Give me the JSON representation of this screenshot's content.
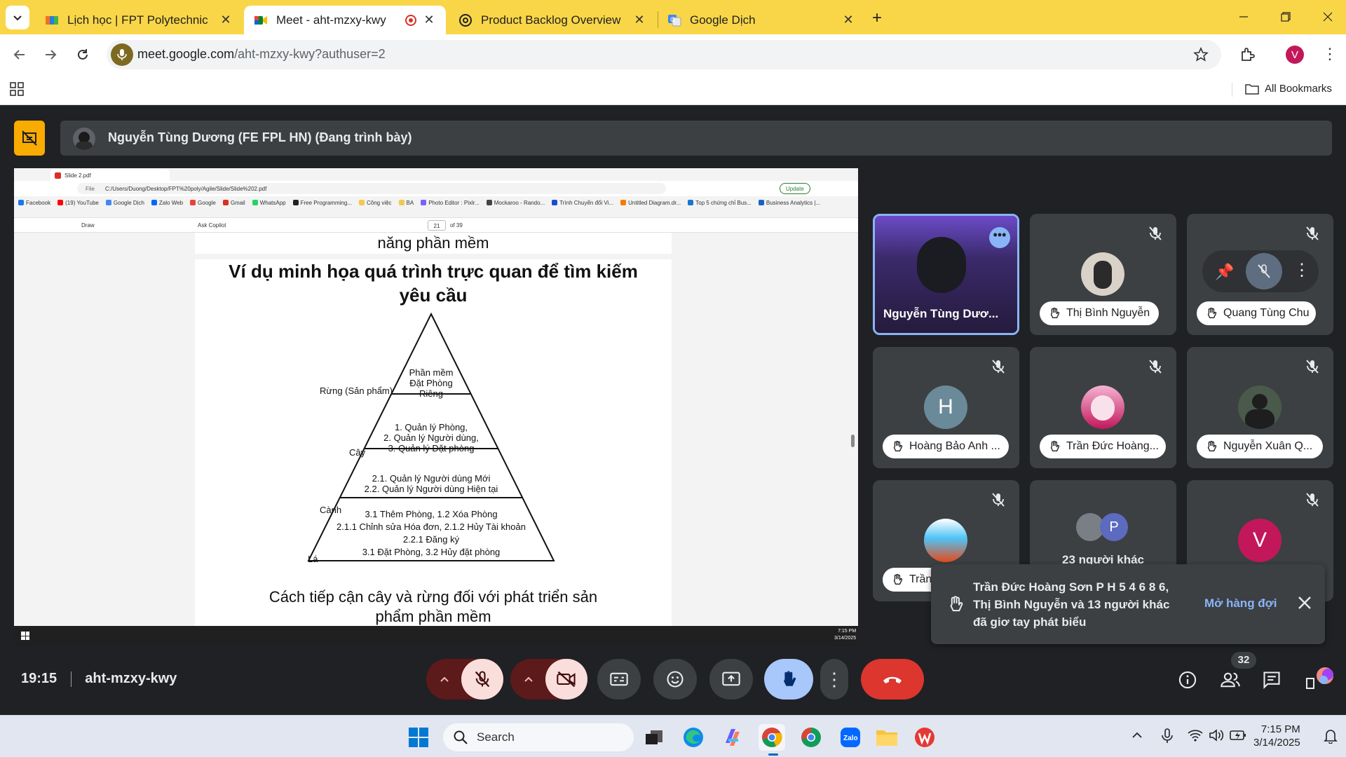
{
  "browser": {
    "tabs": [
      {
        "title": "Lịch học | FPT Polytechnic",
        "active": false
      },
      {
        "title": "Meet - aht-mzxy-kwy",
        "active": true
      },
      {
        "title": "Product Backlog Overview",
        "active": false
      },
      {
        "title": "Google Dịch",
        "active": false
      }
    ],
    "url_host": "meet.google.com",
    "url_path": "/aht-mzxy-kwy?authuser=2",
    "profile_initial": "V",
    "all_bookmarks": "All Bookmarks"
  },
  "meet": {
    "presenter_label": "Nguyễn Tùng Dương (FE FPL HN) (Đang trình bày)",
    "time": "19:15",
    "meeting_code": "aht-mzxy-kwy",
    "participants_count": "32",
    "tiles": [
      {
        "name": "Nguyễn Tùng Dươ...",
        "highlighted": true
      },
      {
        "name": "Thị Bình Nguyễn"
      },
      {
        "name": "Quang Tùng Chu"
      },
      {
        "name": "Hoàng Bảo Anh ...",
        "initial": "H"
      },
      {
        "name": "Trần Đức Hoàng..."
      },
      {
        "name": "Nguyễn Xuân Q..."
      },
      {
        "name": "Trần"
      },
      {
        "name": "23 người khác",
        "badge": "P"
      },
      {
        "name": "",
        "initial": "V"
      }
    ],
    "notification": {
      "text": "Trần Đức Hoàng Sơn P H 5 4 6 8 6, Thị Bình Nguyễn và 13 người khác đã giơ tay phát biểu",
      "action": "Mở hàng đợi"
    }
  },
  "shared_screen": {
    "tab_title": "Slide 2.pdf",
    "address": "C:/Users/Duong/Desktop/FPT%20poly/Agile/Slide/Slide%202.pdf",
    "file_label": "File",
    "update_label": "Update",
    "bookmarks": [
      "Facebook",
      "(19) YouTube",
      "Google Dịch",
      "Zalo Web",
      "Google",
      "Gmail",
      "WhatsApp",
      "Free Programming...",
      "Công việc",
      "BA",
      "Photo Editor : Pixlr...",
      "Mockaroo - Rando...",
      "Trình Chuyển đổi Vi...",
      "Untitled Diagram.dr...",
      "Top 5 chứng chỉ Bus...",
      "Business Analytics |..."
    ],
    "pdf_toolbar": {
      "draw": "Draw",
      "ask_copilot": "Ask Copilot",
      "page": "21",
      "of_pages": "of 39"
    },
    "slide": {
      "prev_caption": "năng phần mềm",
      "title_line1": "Ví dụ minh họa quá trình trực quan để tìm kiếm",
      "title_line2": "yêu cầu",
      "levels": [
        {
          "label": "Rừng (Sản phẩm)",
          "lines": [
            "Phần mềm",
            "Đặt Phòng",
            "Riêng"
          ]
        },
        {
          "label": "Cây",
          "lines": [
            "1.  Quản lý Phòng,",
            "2.  Quản lý Người dùng,",
            "3.  Quản lý Đặt phòng"
          ]
        },
        {
          "label": "Cành",
          "lines": [
            "2.1. Quản lý Người dùng Mới",
            "2.2. Quản lý Người dùng Hiện tại"
          ]
        },
        {
          "label": "Lá",
          "lines": [
            "3.1 Thêm Phòng, 1.2 Xóa Phòng",
            "2.1.1 Chỉnh sửa Hóa đơn, 2.1.2 Hủy Tài khoản",
            "2.2.1 Đăng ký",
            "3.1 Đặt Phòng, 3.2 Hủy đặt phòng"
          ]
        }
      ],
      "caption_line1": "Cách tiếp cận cây và rừng đối với phát triển sản",
      "caption_line2": "phẩm phần mềm"
    },
    "taskbar_time": "7:15 PM",
    "taskbar_date": "3/14/2025"
  },
  "taskbar": {
    "search_placeholder": "Search",
    "time": "7:15 PM",
    "date": "3/14/2025"
  }
}
